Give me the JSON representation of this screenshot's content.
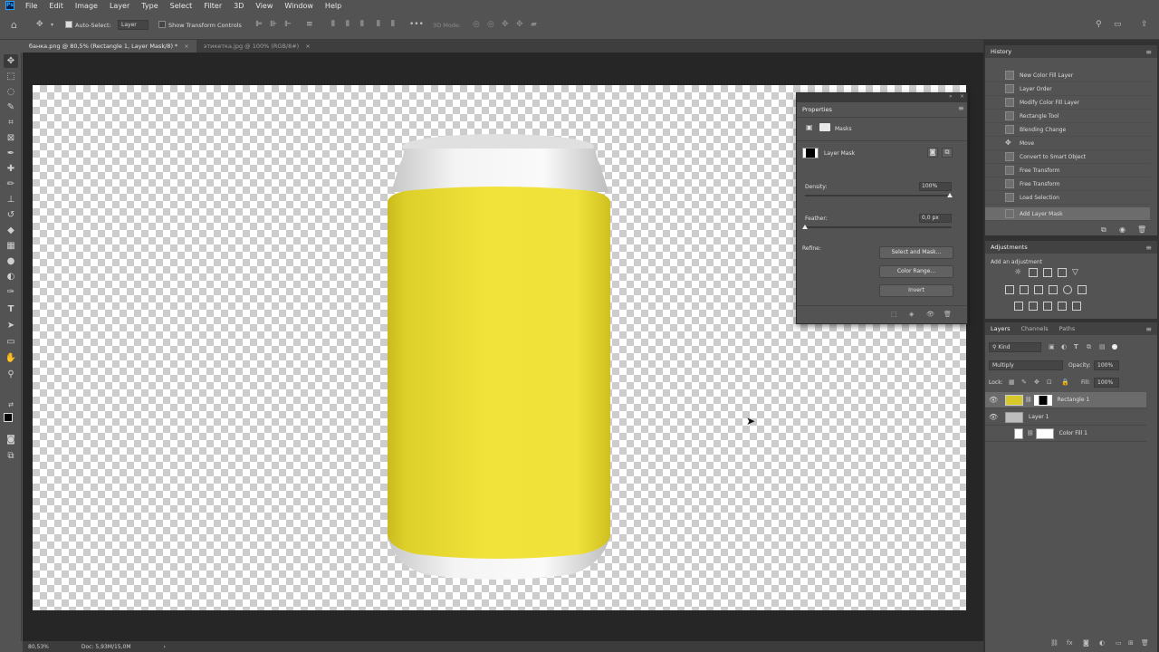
{
  "menubar": {
    "app_logo": "Ps",
    "items": [
      "File",
      "Edit",
      "Image",
      "Layer",
      "Type",
      "Select",
      "Filter",
      "3D",
      "View",
      "Window",
      "Help"
    ]
  },
  "options": {
    "auto_select_label": "Auto-Select:",
    "auto_select_value": "Layer",
    "show_transform_label": "Show Transform Controls",
    "mode_3d_label": "3D Mode:"
  },
  "tabs": [
    {
      "label": "банка.png @ 80,5% (Rectangle 1, Layer Mask/8) *",
      "active": true
    },
    {
      "label": "этикетка.jpg @ 100% (RGB/8#)",
      "active": false
    }
  ],
  "canvas": {
    "can_body_color": "#f2e33a",
    "can_top_color": "#f7f7f7"
  },
  "status": {
    "zoom": "80,53%",
    "doc": "Doc: 5,93M/15,0M"
  },
  "history": {
    "title": "History",
    "items": [
      "New Color Fill Layer",
      "Layer Order",
      "Modify Color Fill Layer",
      "Rectangle Tool",
      "Blending Change",
      "Move",
      "Convert to Smart Object",
      "Free Transform",
      "Free Transform",
      "Load Selection",
      "Add Layer Mask"
    ]
  },
  "adjustments": {
    "title": "Adjustments",
    "subtitle": "Add an adjustment"
  },
  "layers": {
    "tabs": [
      "Layers",
      "Channels",
      "Paths"
    ],
    "kind_label": "Kind",
    "blend_mode": "Multiply",
    "opacity_label": "Opacity:",
    "opacity_value": "100%",
    "lock_label": "Lock:",
    "fill_label": "Fill:",
    "fill_value": "100%",
    "rows": [
      {
        "name": "Rectangle 1",
        "active": true
      },
      {
        "name": "Layer 1",
        "active": false
      },
      {
        "name": "Color Fill 1",
        "active": false
      }
    ]
  },
  "properties": {
    "title": "Properties",
    "section": "Masks",
    "mask_label": "Layer Mask",
    "density_label": "Density:",
    "density_value": "100%",
    "feather_label": "Feather:",
    "feather_value": "0,0 px",
    "refine_label": "Refine:",
    "buttons": [
      "Select and Mask...",
      "Color Range...",
      "Invert"
    ]
  }
}
